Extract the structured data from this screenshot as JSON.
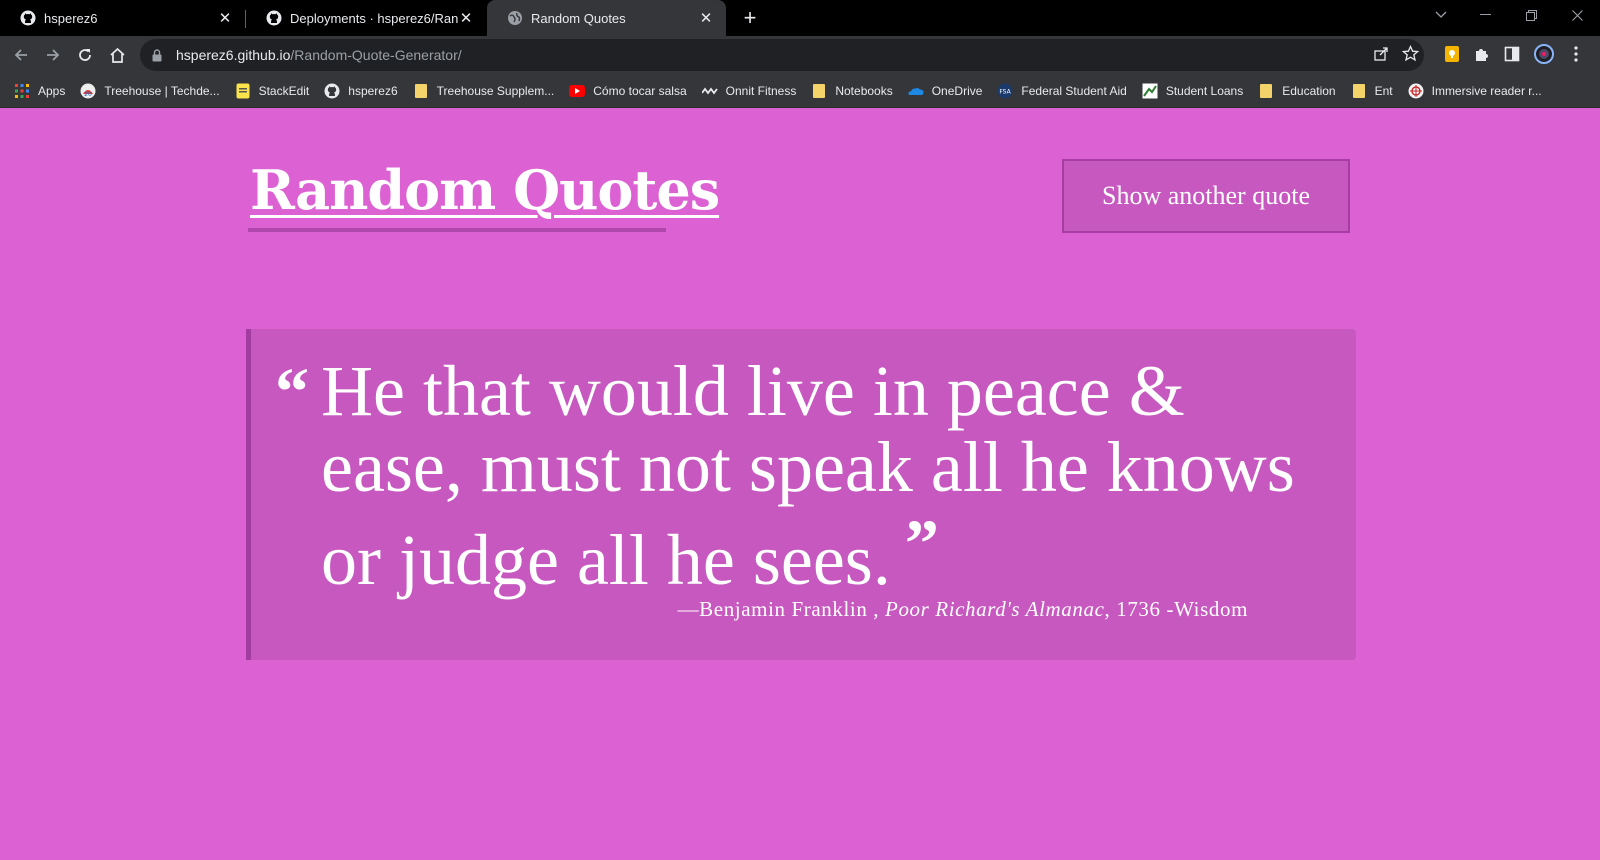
{
  "browser": {
    "tabs": [
      {
        "title": "hsperez6",
        "icon": "github-icon",
        "active": false
      },
      {
        "title": "Deployments · hsperez6/Random-Quote-Generator",
        "icon": "github-icon",
        "active": false
      },
      {
        "title": "Random Quotes",
        "icon": "globe-icon",
        "active": true
      }
    ],
    "address": {
      "host": "hsperez6.github.io",
      "path": "/Random-Quote-Generator/"
    },
    "bookmarks": [
      {
        "label": "Apps",
        "icon": "apps-grid-icon"
      },
      {
        "label": "Treehouse | Techde...",
        "icon": "treehouse-icon"
      },
      {
        "label": "StackEdit",
        "icon": "stackedit-icon"
      },
      {
        "label": "hsperez6",
        "icon": "github-icon"
      },
      {
        "label": "Treehouse Supplem...",
        "icon": "folder-icon"
      },
      {
        "label": "Cómo tocar salsa",
        "icon": "youtube-icon"
      },
      {
        "label": "Onnit Fitness",
        "icon": "onnit-icon"
      },
      {
        "label": "Notebooks",
        "icon": "folder-icon"
      },
      {
        "label": "OneDrive",
        "icon": "onedrive-icon"
      },
      {
        "label": "Federal Student Aid",
        "icon": "fsa-icon"
      },
      {
        "label": "Student Loans",
        "icon": "student-loans-icon"
      },
      {
        "label": "Education",
        "icon": "folder-icon"
      },
      {
        "label": "Ent",
        "icon": "folder-icon"
      },
      {
        "label": "Immersive reader r...",
        "icon": "immersive-reader-icon"
      }
    ]
  },
  "page": {
    "title": "Random Quotes",
    "button_label": "Show another quote",
    "quote": {
      "open_mark": "“",
      "text": "He that would live in peace & ease, must not speak all he knows or judge all he sees.",
      "close_mark": "”",
      "author": "—Benjamin Franklin ,",
      "source": "Poor Richard's Almanac",
      "year": ", 1736 -",
      "tag": "Wisdom"
    }
  },
  "colors": {
    "background": "#dc62d4",
    "panel": "#c658bf",
    "accent_border": "#a33ca0",
    "text": "#ffffff"
  }
}
